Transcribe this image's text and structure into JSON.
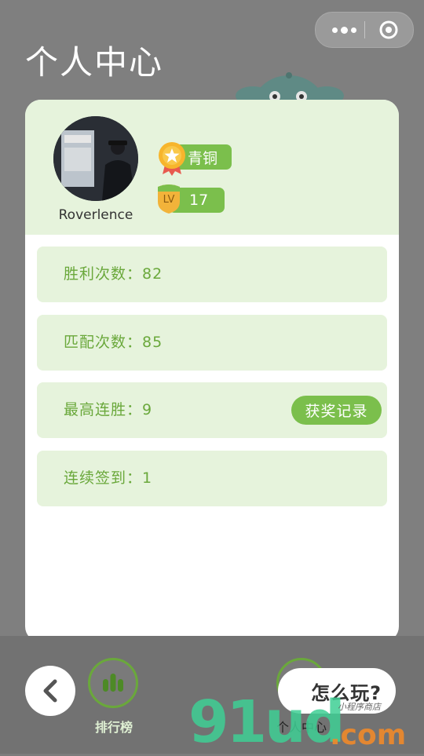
{
  "header": {
    "title": "个人中心"
  },
  "profile": {
    "username": "Roverlence",
    "rank_label": "青铜",
    "level_tag": "LV",
    "level_value": "17"
  },
  "stats": [
    {
      "label": "胜利次数：82"
    },
    {
      "label": "匹配次数：85"
    },
    {
      "label": "最高连胜：9",
      "button": "获奖记录"
    },
    {
      "label": "连续签到：1"
    }
  ],
  "bottom_nav": {
    "rank_label": "排行榜",
    "me_label": "个人中心",
    "howto_label": "怎么玩?"
  },
  "watermark": {
    "main": "91ud",
    "com": ".com",
    "sub": "小程序商店"
  },
  "colors": {
    "accent_green": "#7bbf4c",
    "label_green": "#6aa83b",
    "panel_bg": "#e6f3dc",
    "overlay_gray": "#7f7f7f"
  },
  "icons": [
    "more-icon",
    "target-icon",
    "medal-icon",
    "level-shield-icon",
    "back-chevron-icon",
    "bar-chart-icon",
    "mascot-icon"
  ]
}
